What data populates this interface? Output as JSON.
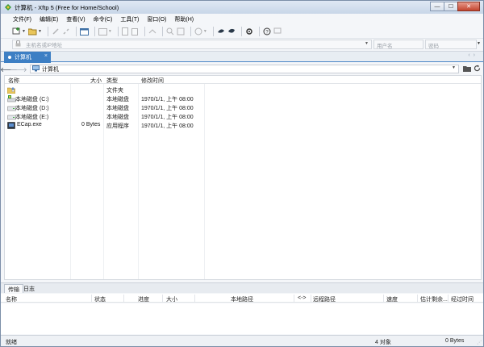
{
  "window": {
    "title": "计算机 - Xftp 5 (Free for Home/School)",
    "controls": {
      "minimize": "—",
      "maximize": "☐",
      "close": "✕"
    }
  },
  "menu": [
    "文件(F)",
    "编辑(E)",
    "查看(V)",
    "命令(C)",
    "工具(T)",
    "窗口(O)",
    "帮助(H)"
  ],
  "address": {
    "host_placeholder": "主机名或IP地址",
    "user_placeholder": "用户名",
    "password_placeholder": "密码"
  },
  "tab": {
    "label": "计算机",
    "close": "×"
  },
  "path": {
    "value": "计算机"
  },
  "columns": {
    "name": "名称",
    "size": "大小",
    "type": "类型",
    "modified": "修改时间"
  },
  "files": [
    {
      "name": "",
      "size": "",
      "type": "文件夹",
      "modified": "",
      "icon": "user-folder-icon"
    },
    {
      "name": "本地磁盘 (C:)",
      "size": "",
      "type": "本地磁盘",
      "modified": "1970/1/1, 上午 08:00",
      "icon": "system-drive-icon"
    },
    {
      "name": "本地磁盘 (D:)",
      "size": "",
      "type": "本地磁盘",
      "modified": "1970/1/1, 上午 08:00",
      "icon": "drive-icon"
    },
    {
      "name": "本地磁盘 (E:)",
      "size": "",
      "type": "本地磁盘",
      "modified": "1970/1/1, 上午 08:00",
      "icon": "drive-icon"
    },
    {
      "name": "ECap.exe",
      "size": "0 Bytes",
      "type": "应用程序",
      "modified": "1970/1/1, 上午 08:00",
      "icon": "exe-icon"
    }
  ],
  "bottom_tabs": [
    "传输",
    "日志"
  ],
  "transfer_columns": {
    "name": "名称",
    "status": "状态",
    "progress": "进度",
    "size": "大小",
    "local_path": "本地路径",
    "direction": "<->",
    "remote_path": "远程路径",
    "speed": "速度",
    "eta": "估计剩余...",
    "elapsed": "经过时间"
  },
  "status": {
    "left": "就绪",
    "count": "4 对象",
    "size": "0 Bytes"
  },
  "colors": {
    "tab_active": "#3d7fc4",
    "title_bg": "#d4dfee"
  }
}
